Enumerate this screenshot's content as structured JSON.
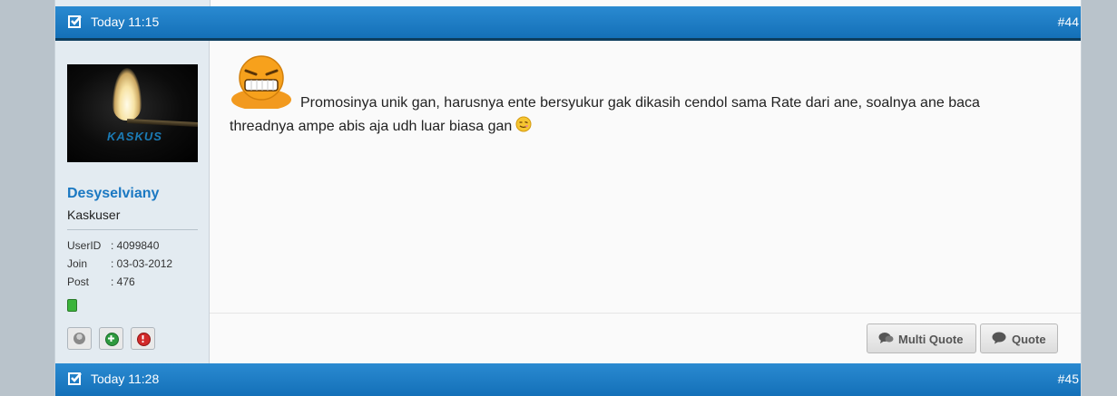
{
  "posts": [
    {
      "time": "Today 11:15",
      "number": "#44"
    },
    {
      "time": "Today 11:28",
      "number": "#45"
    }
  ],
  "user": {
    "avatar_text": "KASKUS",
    "name": "Desyselviany",
    "title": "Kaskuser",
    "stats": [
      {
        "key": "UserID",
        "value": ": 4099840"
      },
      {
        "key": "Join",
        "value": ": 03-03-2012"
      },
      {
        "key": "Post",
        "value": ": 476"
      }
    ],
    "status_color": "#3bb43b"
  },
  "post_body": {
    "text": "Promosinya unik gan, harusnya ente bersyukur gak dikasih cendol sama Rate dari ane, soalnya ane baca threadnya ampe abis aja udh luar biasa gan"
  },
  "actions": {
    "multi_quote": "Multi Quote",
    "quote": "Quote"
  },
  "colors": {
    "header_blue": "#1470b8",
    "username_blue": "#1a78c2",
    "sidebar_bg": "#e3ebf1"
  }
}
